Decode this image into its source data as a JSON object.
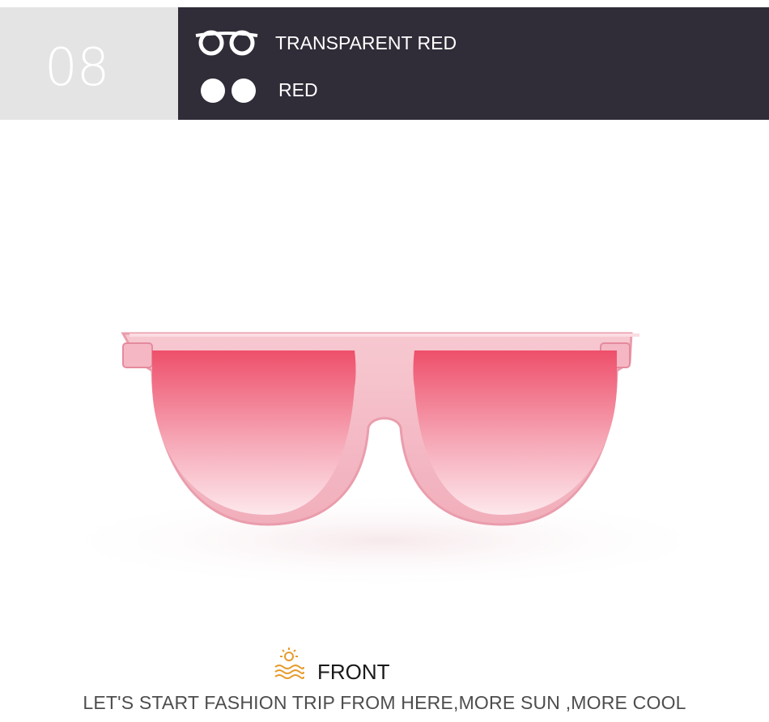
{
  "badge": {
    "number": "08"
  },
  "variant": {
    "frame_icon": "glasses-frame-icon",
    "frame_color": "TRANSPARENT RED",
    "lens_icon": "lens-circles-icon",
    "lens_color": "RED"
  },
  "colors": {
    "badge_bg": "#e4e4e4",
    "header_bg": "#302c38",
    "frame": "#f4b8c4",
    "lens_top": "#f0566e",
    "lens_bottom": "#fbe3e8"
  },
  "caption": {
    "icon": "sun-over-waves-icon",
    "label": "FRONT",
    "tagline": "LET'S START FASHION TRIP FROM HERE,MORE SUN ,MORE COOL"
  }
}
